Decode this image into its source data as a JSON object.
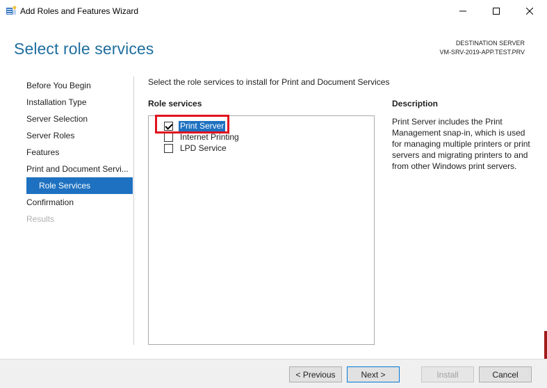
{
  "window": {
    "title": "Add Roles and Features Wizard"
  },
  "header": {
    "page_title": "Select role services",
    "destination_label": "DESTINATION SERVER",
    "destination_server": "VM-SRV-2019-APP.TEST.PRV"
  },
  "nav": {
    "items": [
      {
        "label": "Before You Begin",
        "state": "normal"
      },
      {
        "label": "Installation Type",
        "state": "normal"
      },
      {
        "label": "Server Selection",
        "state": "normal"
      },
      {
        "label": "Server Roles",
        "state": "normal"
      },
      {
        "label": "Features",
        "state": "normal"
      },
      {
        "label": "Print and Document Servi...",
        "state": "normal"
      },
      {
        "label": "Role Services",
        "state": "selected"
      },
      {
        "label": "Confirmation",
        "state": "normal"
      },
      {
        "label": "Results",
        "state": "disabled"
      }
    ]
  },
  "content": {
    "instruction": "Select the role services to install for Print and Document Services",
    "role_services_heading": "Role services",
    "roles": [
      {
        "label": "Print Server",
        "checked": true,
        "selected": true
      },
      {
        "label": "Internet Printing",
        "checked": false,
        "selected": false
      },
      {
        "label": "LPD Service",
        "checked": false,
        "selected": false
      }
    ],
    "description_heading": "Description",
    "description_text": "Print Server includes the Print Management snap-in, which is used for managing multiple printers or print servers and migrating printers to and from other Windows print servers."
  },
  "footer": {
    "previous_label": "< Previous",
    "next_label": "Next >",
    "install_label": "Install",
    "cancel_label": "Cancel"
  },
  "colors": {
    "title_blue": "#1f6ea0",
    "selection_blue": "#1e71c0",
    "highlight_red": "#e0131e"
  }
}
